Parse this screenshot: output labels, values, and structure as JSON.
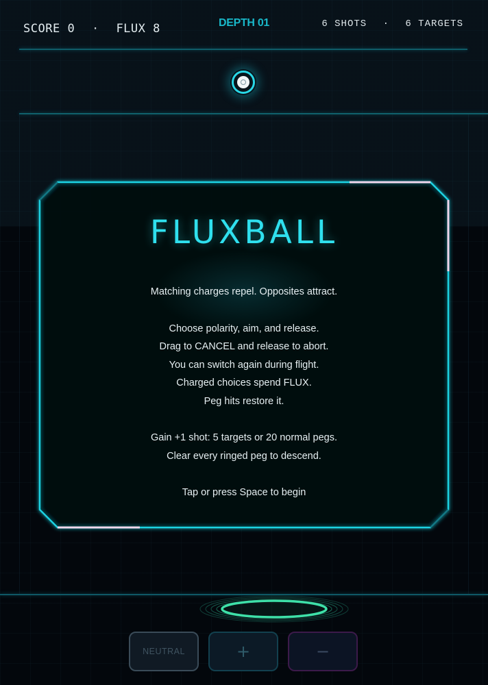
{
  "hud": {
    "score_label": "SCORE",
    "score_value": "0",
    "separator": "·",
    "flux_label": "FLUX",
    "flux_value": "8",
    "depth_label": "DEPTH 01",
    "shots_text": "6 SHOTS",
    "targets_text": "6 TARGETS"
  },
  "intro": {
    "title": "FLUXBALL",
    "lines": [
      "Matching charges repel. Opposites attract.",
      "",
      "Choose polarity, aim, and release.",
      "Drag to CANCEL and release to abort.",
      "You can switch again during flight.",
      "Charged choices spend FLUX.",
      "Peg hits restore it.",
      "",
      "Gain +1 shot: 5 targets or 20 normal pegs.",
      "Clear every ringed peg to descend.",
      "",
      "Tap or press Space to begin"
    ]
  },
  "controls": {
    "neutral_label": "NEUTRAL",
    "plus_label": "+",
    "minus_label": "−"
  },
  "colors": {
    "accent_cyan": "#2fe0ee",
    "depth_teal": "#19b8c9",
    "panel_corner_pink": "#f0d6ec",
    "target_green": "#3ee0a8",
    "background": "#03070c"
  },
  "icons": {
    "launcher": "launcher-ball-icon",
    "bucket": "target-bucket-icon"
  }
}
